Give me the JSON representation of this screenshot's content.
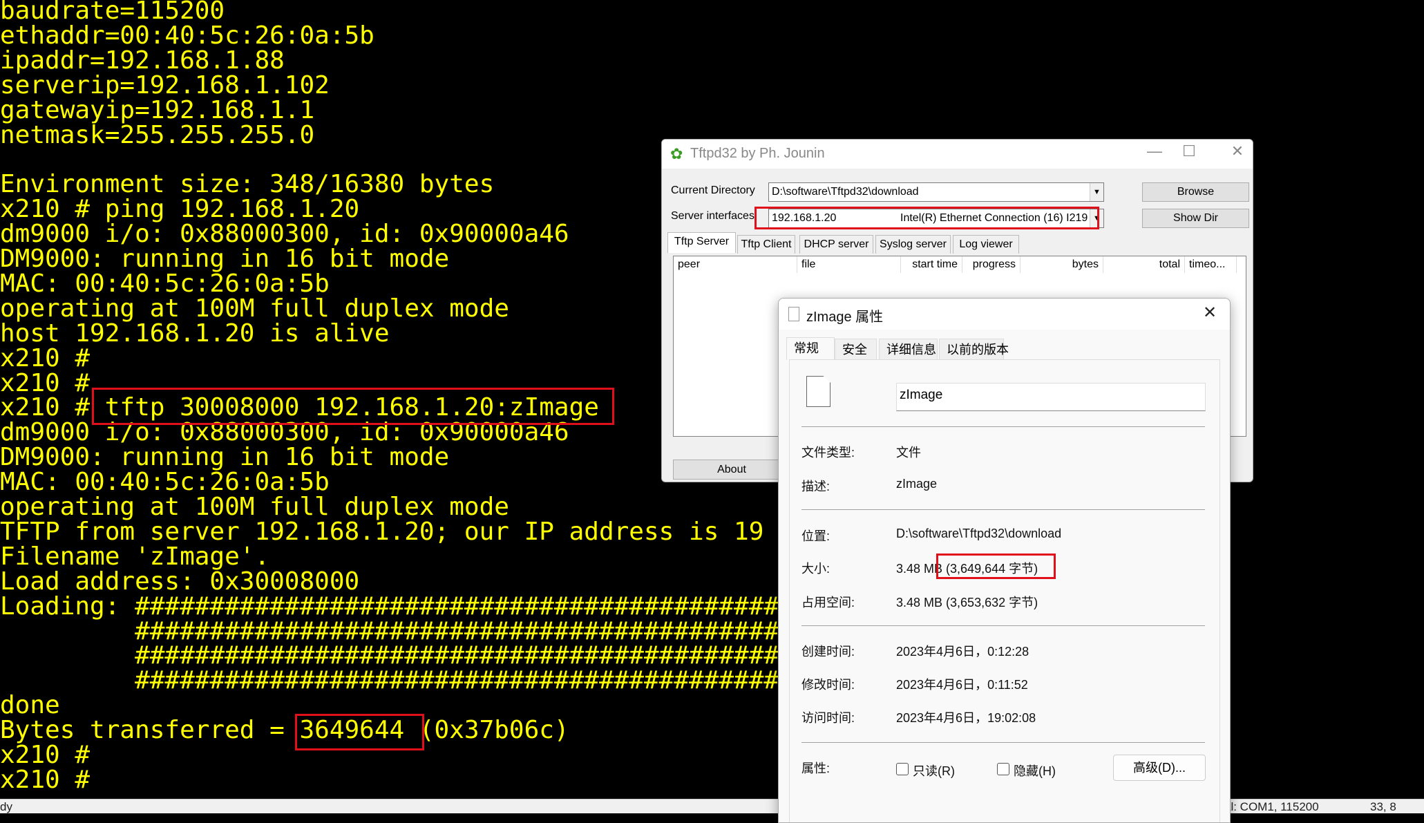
{
  "terminal": {
    "lines": [
      "baudrate=115200",
      "ethaddr=00:40:5c:26:0a:5b",
      "ipaddr=192.168.1.88",
      "serverip=192.168.1.102",
      "gatewayip=192.168.1.1",
      "netmask=255.255.255.0",
      "",
      "Environment size: 348/16380 bytes",
      "x210 # ping 192.168.1.20",
      "dm9000 i/o: 0x88000300, id: 0x90000a46",
      "DM9000: running in 16 bit mode",
      "MAC: 00:40:5c:26:0a:5b",
      "operating at 100M full duplex mode",
      "host 192.168.1.20 is alive",
      "x210 #",
      "x210 #",
      "x210 # tftp 30008000 192.168.1.20:zImage",
      "dm9000 i/o: 0x88000300, id: 0x90000a46",
      "DM9000: running in 16 bit mode",
      "MAC: 00:40:5c:26:0a:5b",
      "operating at 100M full duplex mode",
      "TFTP from server 192.168.1.20; our IP address is 19",
      "Filename 'zImage'.",
      "Load address: 0x30008000",
      "Loading: ##################################################",
      "         ##################################################",
      "         ##################################################",
      "         ##################################################",
      "done",
      "Bytes transferred = 3649644 (0x37b06c)",
      "x210 #",
      "x210 #"
    ]
  },
  "status_bar": {
    "left": "dy",
    "port": "al: COM1, 115200",
    "pos": "33, 8"
  },
  "tftpd": {
    "title": "Tftpd32 by Ph. Jounin",
    "current_directory_label": "Current Directory",
    "current_directory": "D:\\software\\Tftpd32\\download",
    "server_interfaces_label": "Server interfaces",
    "server_ip": "192.168.1.20",
    "server_adapter": "Intel(R) Ethernet Connection (16) I219",
    "browse": "Browse",
    "show_dir": "Show Dir",
    "about": "About",
    "tabs": [
      "Tftp Server",
      "Tftp Client",
      "DHCP server",
      "Syslog server",
      "Log viewer"
    ],
    "columns": [
      "peer",
      "file",
      "start time",
      "progress",
      "bytes",
      "total",
      "timeo..."
    ]
  },
  "props": {
    "title": "zImage 属性",
    "tabs": [
      "常规",
      "安全",
      "详细信息",
      "以前的版本"
    ],
    "filename": "zImage",
    "rows": [
      {
        "label": "文件类型:",
        "value": "文件"
      },
      {
        "label": "描述:",
        "value": "zImage"
      },
      {
        "label": "位置:",
        "value": "D:\\software\\Tftpd32\\download"
      },
      {
        "label": "大小:",
        "value": "3.48 MB (3,649,644 字节)"
      },
      {
        "label": "占用空间:",
        "value": "3.48 MB (3,653,632 字节)"
      },
      {
        "label": "创建时间:",
        "value": "2023年4月6日，0:12:28"
      },
      {
        "label": "修改时间:",
        "value": "2023年4月6日，0:11:52"
      },
      {
        "label": "访问时间:",
        "value": "2023年4月6日，19:02:08"
      }
    ],
    "attributes_label": "属性:",
    "readonly": "只读(R)",
    "hidden": "隐藏(H)",
    "advanced": "高级(D)...",
    "readonly_checked": false,
    "hidden_checked": false
  },
  "colors": {
    "terminal_fg": "#ffff00",
    "terminal_bg": "#000000",
    "highlight": "#e0101a"
  }
}
